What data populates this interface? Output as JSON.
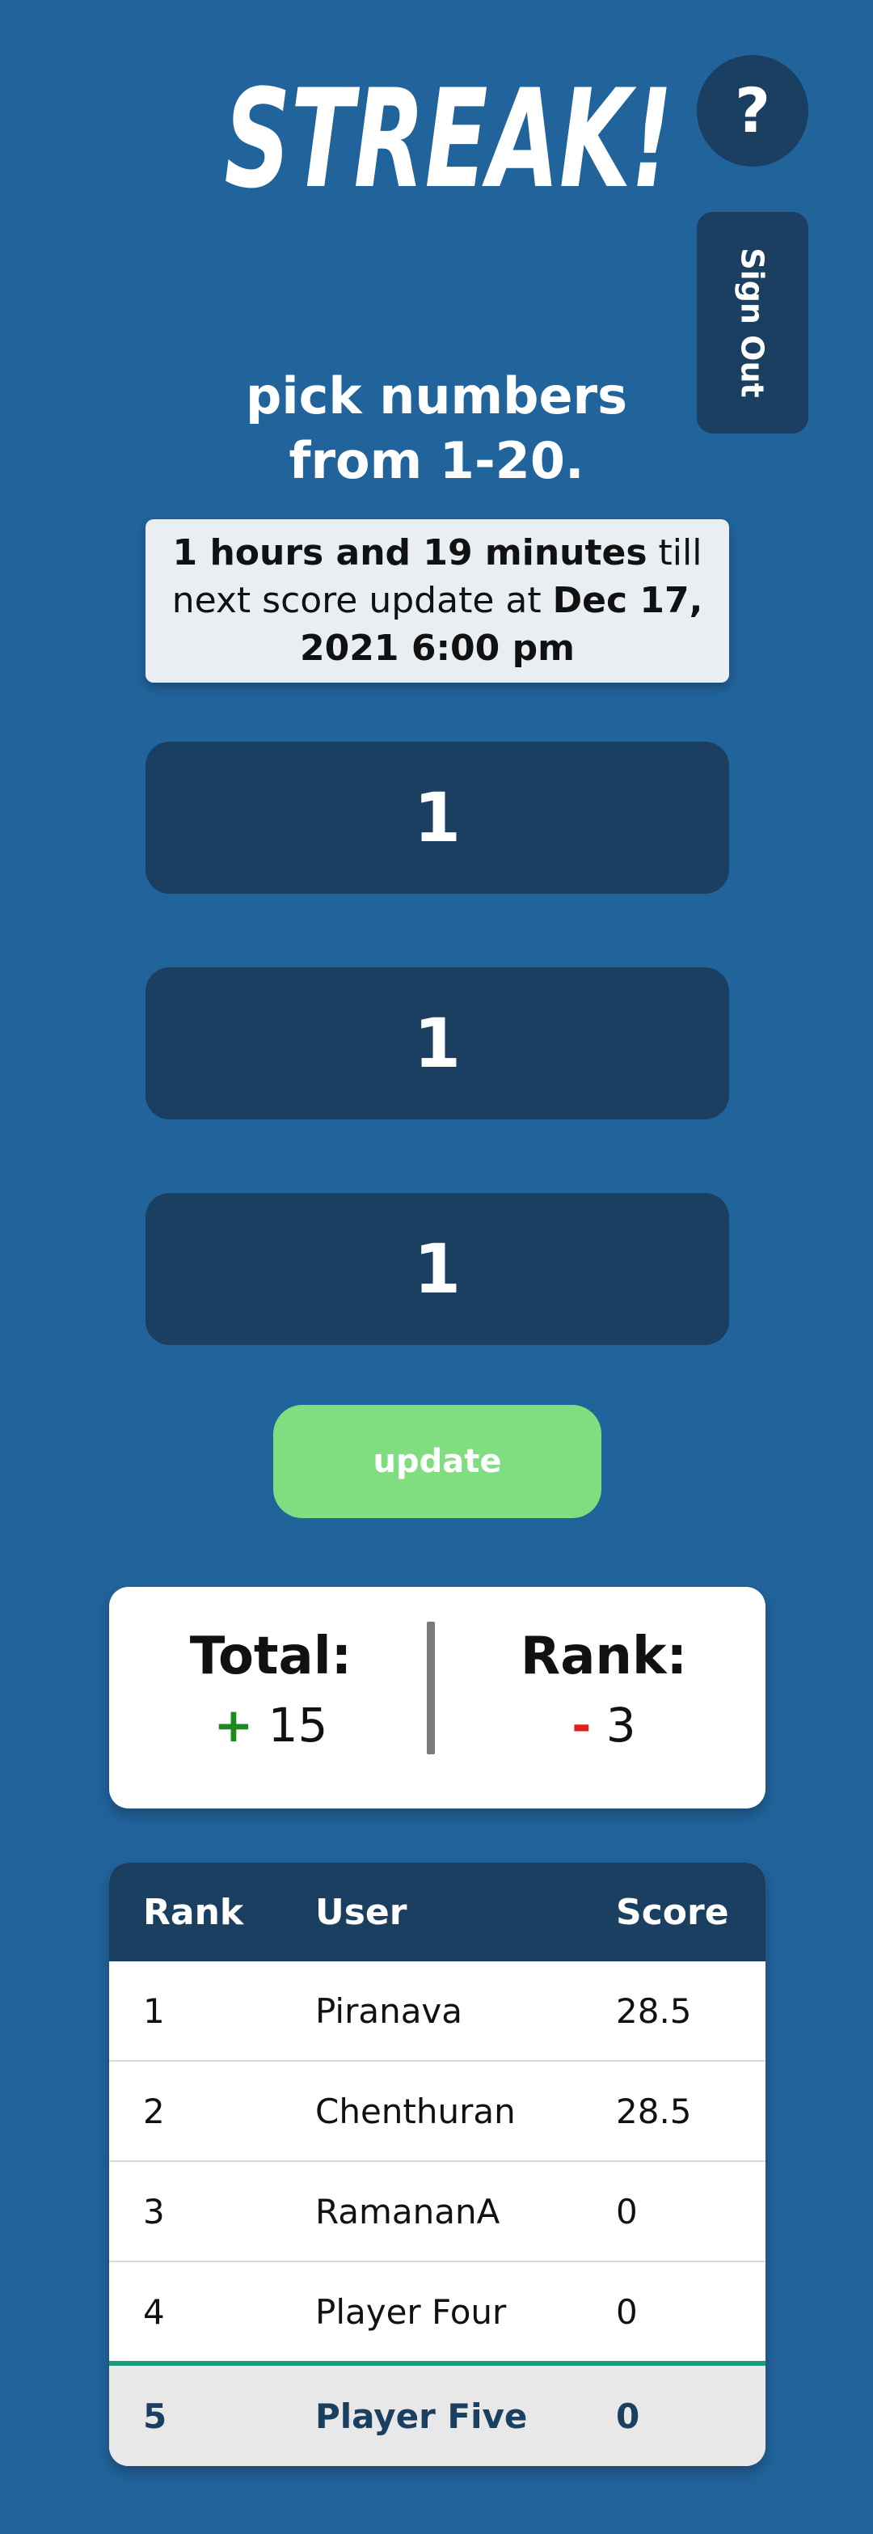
{
  "app": {
    "logo_text": "STREAK!",
    "help_label": "?",
    "signout_label": "Sign Out"
  },
  "instructions": {
    "line1": "pick numbers",
    "line2": "from 1-20."
  },
  "countdown": {
    "duration": "1 hours and 19 minutes",
    "mid_text": " till next score update at ",
    "datetime": "Dec 17, 2021 6:00 pm"
  },
  "picks": [
    "1",
    "1",
    "1"
  ],
  "update_label": "update",
  "summary": {
    "total_label": "Total:",
    "total_sign": "+",
    "total_value": "15",
    "rank_label": "Rank:",
    "rank_sign": "-",
    "rank_value": "3"
  },
  "leaderboard": {
    "headers": [
      "Rank",
      "User",
      "Score"
    ],
    "rows": [
      {
        "rank": "1",
        "user": "Piranava",
        "score": "28.5"
      },
      {
        "rank": "2",
        "user": "Chenthuran",
        "score": "28.5"
      },
      {
        "rank": "3",
        "user": "RamananA",
        "score": "0"
      },
      {
        "rank": "4",
        "user": "Player Four",
        "score": "0"
      },
      {
        "rank": "5",
        "user": "Player Five",
        "score": "0"
      }
    ]
  },
  "colors": {
    "background": "#21639b",
    "dark_panel": "#1a3f61",
    "update_button": "#80de80",
    "highlight_border": "#1c9a7c",
    "positive": "#1c8a1c",
    "negative": "#e02020"
  }
}
